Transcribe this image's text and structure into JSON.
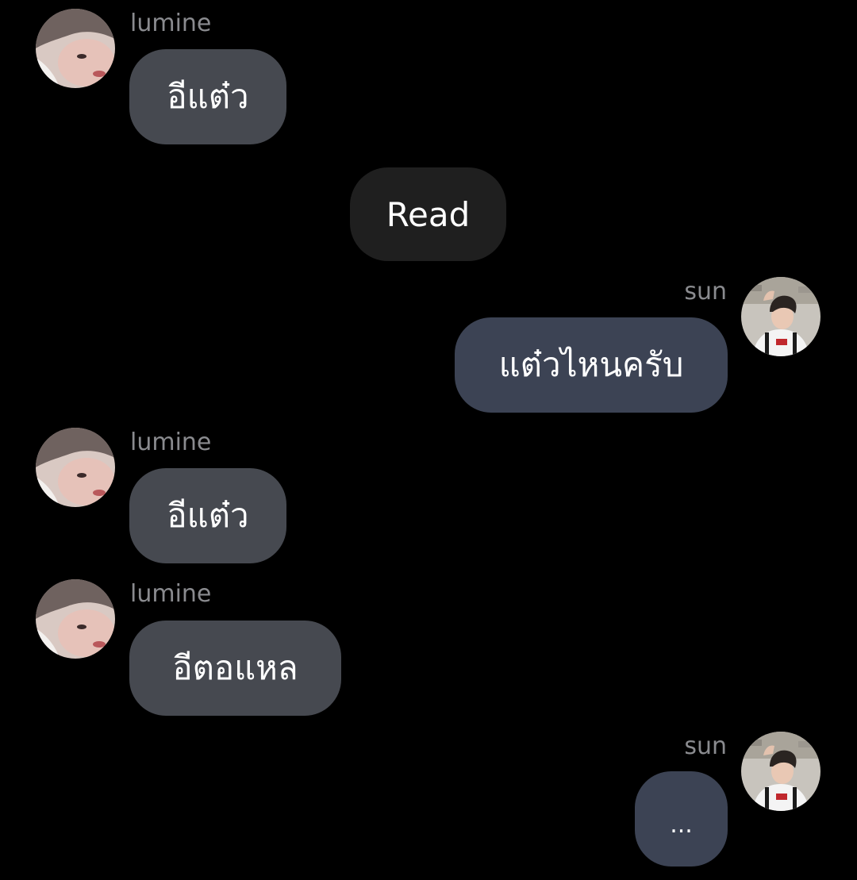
{
  "colors": {
    "background": "#000000",
    "incoming_bubble": "#464950",
    "outgoing_bubble": "#3c4354",
    "status_bubble": "#1f1f1f",
    "sender_name": "#8a8b8f",
    "text": "#ffffff"
  },
  "icons": {
    "lumine_avatar": "avatar-photo-lumine",
    "sun_avatar": "avatar-photo-sun"
  },
  "messages": [
    {
      "sender": "lumine",
      "direction": "incoming",
      "text": "อีแต๋ว"
    },
    {
      "type": "status",
      "text": "Read"
    },
    {
      "sender": "sun",
      "direction": "outgoing",
      "text": "แต๋วไหนครับ"
    },
    {
      "sender": "lumine",
      "direction": "incoming",
      "text": "อีแต๋ว"
    },
    {
      "sender": "lumine",
      "direction": "incoming",
      "text": "อีตอแหล"
    },
    {
      "sender": "sun",
      "direction": "outgoing",
      "text": "..."
    }
  ]
}
